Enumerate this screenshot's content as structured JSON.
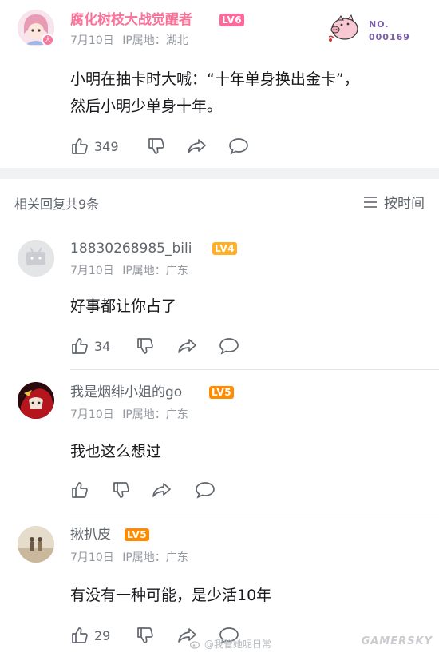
{
  "main_comment": {
    "username": "腐化树枝大战觉醒者",
    "level": "LV6",
    "level_color": "#ff6699",
    "username_color": "#fb7299",
    "date": "7月10日",
    "ip": "IP属地：湖北",
    "content_line1": "小明在抽卡时大喊：“十年单身换出金卡”，",
    "content_line2": "然后小明少单身十年。",
    "like_count": "349",
    "badge_no_label": "NO.",
    "badge_no_value": "000169"
  },
  "replies_header": {
    "count_label": "相关回复共9条",
    "sort_label": "按时间"
  },
  "replies": [
    {
      "username": "18830268985_bili",
      "level": "LV4",
      "level_color": "#ffb027",
      "date": "7月10日",
      "ip": "IP属地：广东",
      "content": "好事都让你占了",
      "like_count": "34"
    },
    {
      "username": "我是烟绯小姐的go",
      "level": "LV5",
      "level_color": "#ff8c00",
      "date": "7月10日",
      "ip": "IP属地：广东",
      "content": "我也这么想过",
      "like_count": ""
    },
    {
      "username": "揪扒皮",
      "level": "LV5",
      "level_color": "#ff8c00",
      "date": "7月10日",
      "ip": "IP属地：广东",
      "content": "有没有一种可能，是少活10年",
      "like_count": "29"
    }
  ],
  "watermarks": {
    "weibo": "@我管她呢日常",
    "site": "GAMERSKY"
  },
  "colors": {
    "meta_gray": "#9499a0",
    "separator": "#f1f2f3"
  }
}
